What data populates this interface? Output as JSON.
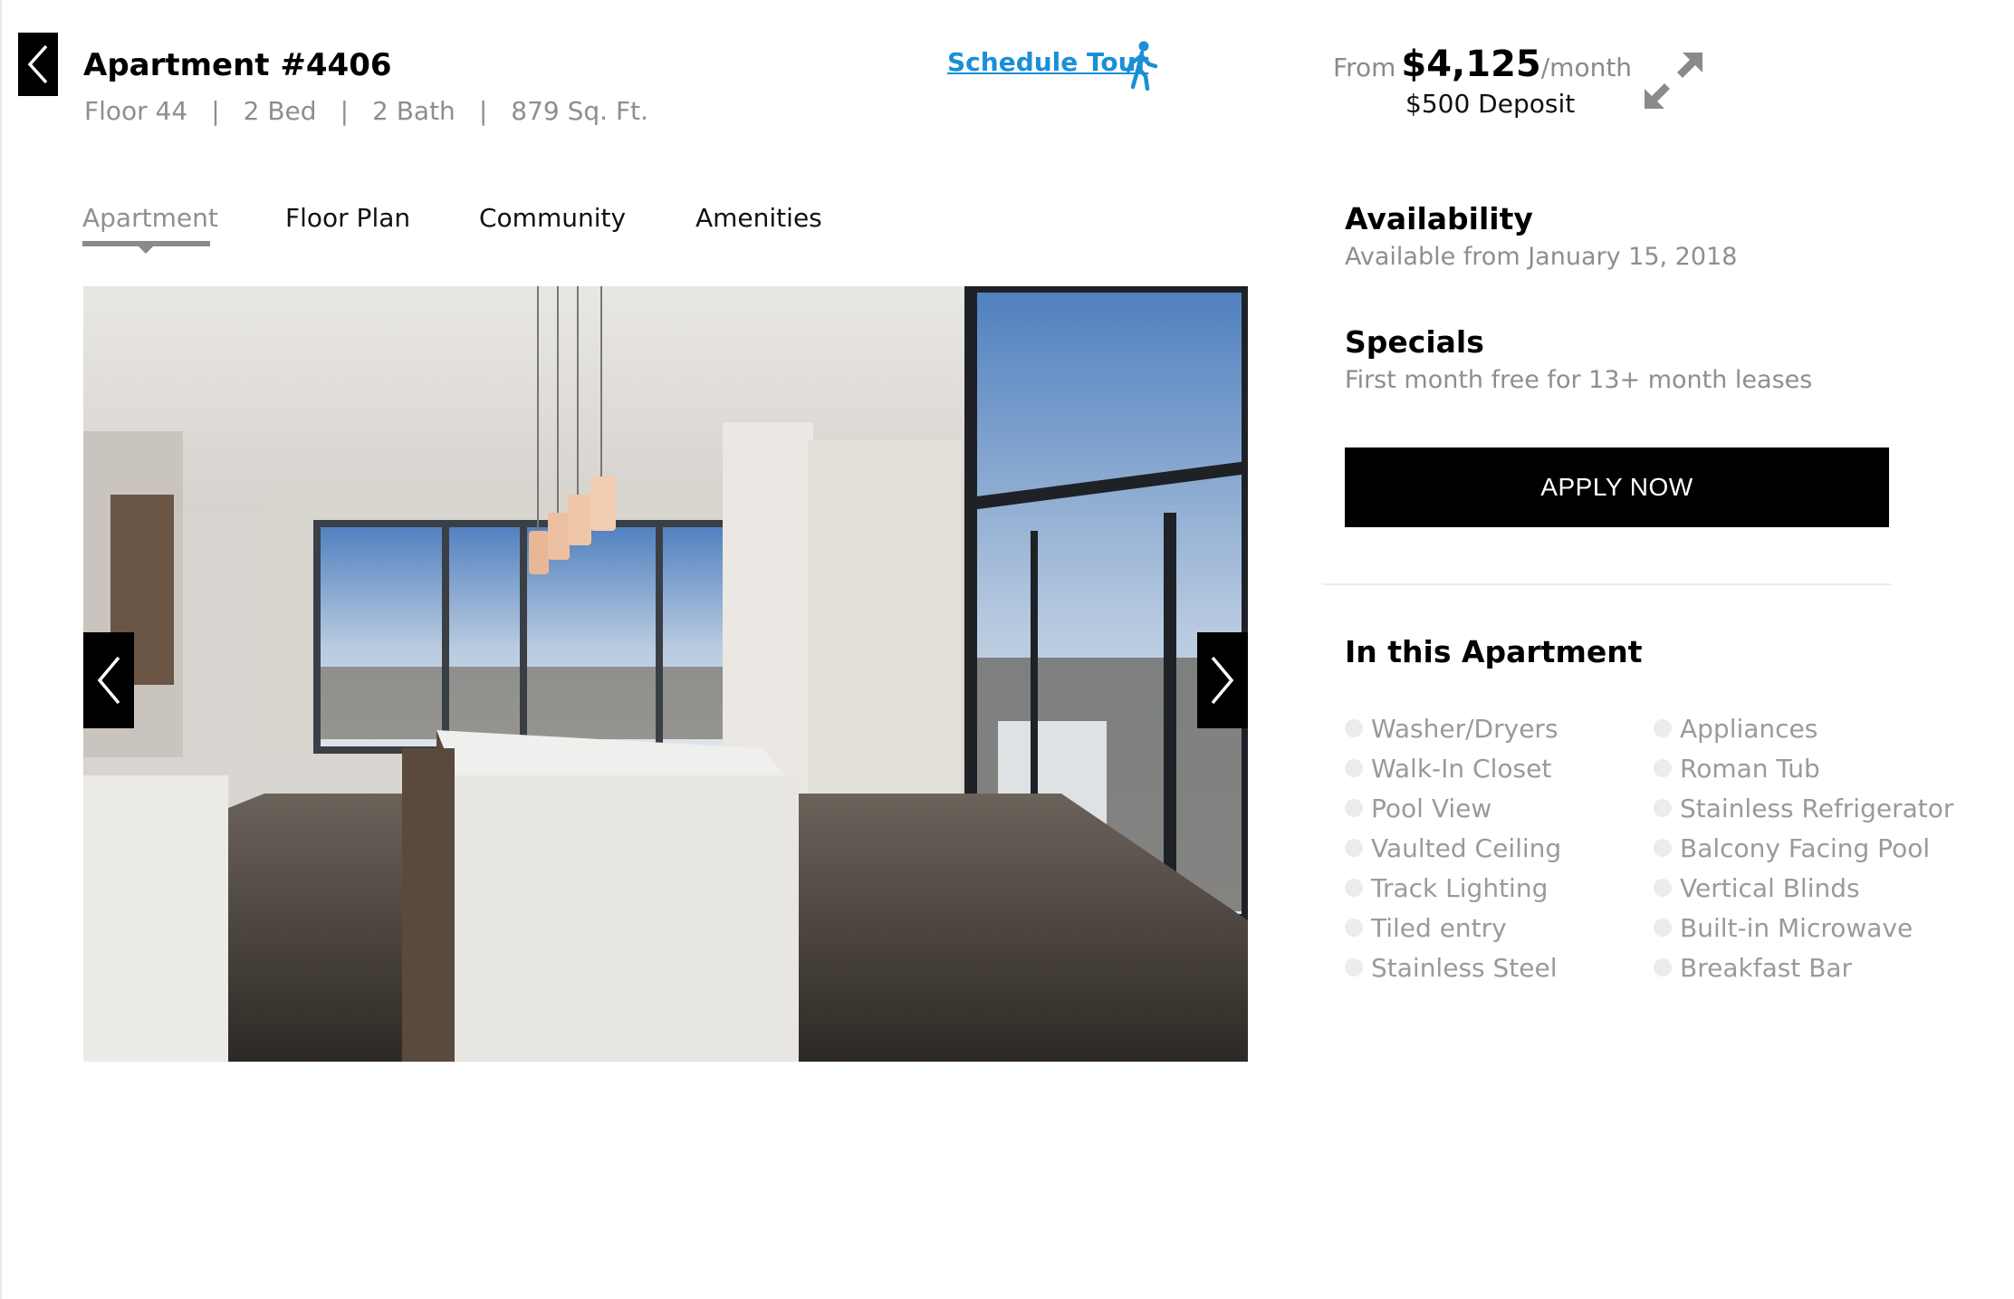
{
  "header": {
    "title": "Apartment #4406",
    "meta": [
      "Floor 44",
      "2 Bed",
      "2 Bath",
      "879 Sq. Ft."
    ],
    "separator": "|",
    "schedule_tour": "Schedule Tour",
    "price_prefix": "From",
    "price_amount": "$4,125",
    "price_suffix": "/month",
    "deposit": "$500 Deposit"
  },
  "tabs": [
    {
      "label": "Apartment",
      "active": true
    },
    {
      "label": "Floor Plan",
      "active": false
    },
    {
      "label": "Community",
      "active": false
    },
    {
      "label": "Amenities",
      "active": false
    }
  ],
  "availability": {
    "title": "Availability",
    "text": "Available from January 15, 2018"
  },
  "specials": {
    "title": "Specials",
    "text": "First month free for 13+ month leases"
  },
  "apply_label": "APPLY NOW",
  "features": {
    "title": "In this Apartment",
    "left": [
      "Washer/Dryers",
      "Walk-In Closet",
      "Pool View",
      "Vaulted Ceiling",
      "Track Lighting",
      "Tiled entry",
      "Stainless Steel"
    ],
    "right": [
      "Appliances",
      "Roman Tub",
      "Stainless Refrigerator",
      "Balcony Facing Pool",
      "Vertical Blinds",
      "Built-in Microwave",
      "Breakfast Bar"
    ]
  },
  "icons": {
    "back": "chevron-left-icon",
    "tour": "walking-person-icon",
    "expand": "expand-arrows-icon",
    "prev": "chevron-left-icon",
    "next": "chevron-right-icon"
  },
  "colors": {
    "accent": "#1a8fd6",
    "button": "#000000",
    "muted_text": "#8e8e8e"
  }
}
